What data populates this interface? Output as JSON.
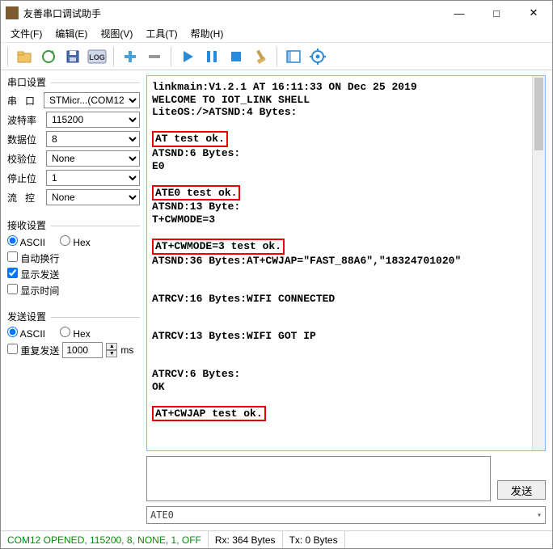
{
  "window": {
    "title": "友善串口调试助手",
    "buttons": {
      "min": "—",
      "max": "□",
      "close": "✕"
    }
  },
  "menu": {
    "file": "文件(F)",
    "edit": "编辑(E)",
    "view": "视图(V)",
    "tools": "工具(T)",
    "help": "帮助(H)"
  },
  "toolbar_icons": {
    "folder": "folder-icon",
    "refresh": "refresh-icon",
    "save": "save-icon",
    "log": "log-icon",
    "plus": "plus-icon",
    "minus": "minus-icon",
    "play": "play-icon",
    "pause": "pause-icon",
    "stop": "stop-icon",
    "clear": "clear-icon",
    "sidebar": "sidebar-icon",
    "settings": "settings-icon"
  },
  "serial": {
    "group_title": "串口设置",
    "port_label": "串   口",
    "port_value": "STMicr...(COM12",
    "baud_label": "波特率",
    "baud_value": "115200",
    "data_label": "数据位",
    "data_value": "8",
    "parity_label": "校验位",
    "parity_value": "None",
    "stop_label": "停止位",
    "stop_value": "1",
    "flow_label": "流   控",
    "flow_value": "None"
  },
  "recv": {
    "group_title": "接收设置",
    "ascii": "ASCII",
    "hex": "Hex",
    "wrap": "自动换行",
    "showsend": "显示发送",
    "showtime": "显示时间",
    "radio_selected": "ascii",
    "wrap_checked": false,
    "showsend_checked": true,
    "showtime_checked": false
  },
  "send": {
    "group_title": "发送设置",
    "ascii": "ASCII",
    "hex": "Hex",
    "repeat": "重复发送",
    "interval": "1000",
    "unit": "ms",
    "radio_selected": "ascii",
    "repeat_checked": false,
    "button": "发送"
  },
  "console": {
    "l1": "linkmain:V1.2.1 AT 16:11:33 ON Dec 25 2019",
    "l2": "WELCOME TO IOT_LINK SHELL",
    "l3": "LiteOS:/>ATSND:4 Bytes:",
    "h1": "AT test ok.",
    "l4": "ATSND:6 Bytes:",
    "l5": "E0",
    "h2": "ATE0 test ok.",
    "l6": "ATSND:13 Byte:",
    "l7": "T+CWMODE=3",
    "h3": "AT+CWMODE=3 test ok.",
    "l8": "ATSND:36 Bytes:AT+CWJAP=\"FAST_88A6\",\"18324701020\"",
    "l9": "ATRCV:16 Bytes:WIFI CONNECTED",
    "l10": "ATRCV:13 Bytes:WIFI GOT IP",
    "l11": "ATRCV:6 Bytes:",
    "l12": "OK",
    "h4": "AT+CWJAP test ok."
  },
  "dropdown_value": "ATE0",
  "status": {
    "open": "COM12 OPENED, 115200, 8, NONE, 1, OFF",
    "rx": "Rx: 364 Bytes",
    "tx": "Tx: 0 Bytes"
  }
}
